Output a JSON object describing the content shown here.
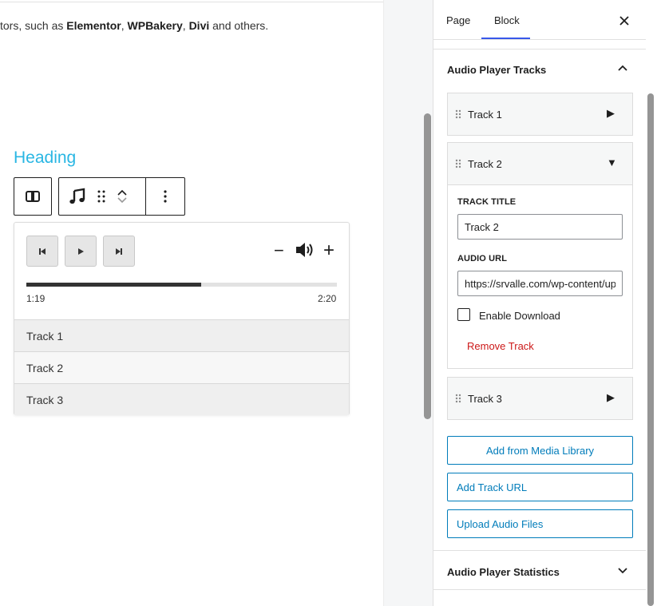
{
  "editor": {
    "intro": {
      "prefix": "tors, such as ",
      "b1": "Elementor",
      "sep1": ", ",
      "b2": "WPBakery",
      "sep2": ", ",
      "b3": "Divi",
      "suffix": " and others."
    },
    "heading": "Heading",
    "player": {
      "current_time": "1:19",
      "total_time": "2:20",
      "progress_fraction": 0.563,
      "tracks": [
        "Track 1",
        "Track 2",
        "Track 3"
      ]
    }
  },
  "sidebar": {
    "tabs": {
      "page": "Page",
      "block": "Block"
    },
    "active_tab": "Block",
    "tracks_panel": {
      "title": "Audio Player Tracks",
      "tracks": [
        {
          "title": "Track 1",
          "arrow": "▶"
        },
        {
          "title": "Track 2",
          "arrow": "▼"
        },
        {
          "title": "Track 3",
          "arrow": "▶"
        }
      ],
      "expanded": {
        "track_title_label": "Track title",
        "track_title_value": "Track 2",
        "audio_url_label": "Audio URL",
        "audio_url_value": "https://srvalle.com/wp-content/uploads/",
        "enable_download_label": "Enable Download",
        "enable_download_checked": false,
        "remove_label": "Remove Track"
      },
      "buttons": {
        "media_library": "Add from Media Library",
        "track_url": "Add Track URL",
        "upload": "Upload Audio Files"
      }
    },
    "stats_panel": {
      "title": "Audio Player Statistics"
    }
  },
  "colors": {
    "accent": "#007cba",
    "heading": "#29b6e3",
    "danger": "#cc1818",
    "tab_indicator": "#3858e9"
  }
}
